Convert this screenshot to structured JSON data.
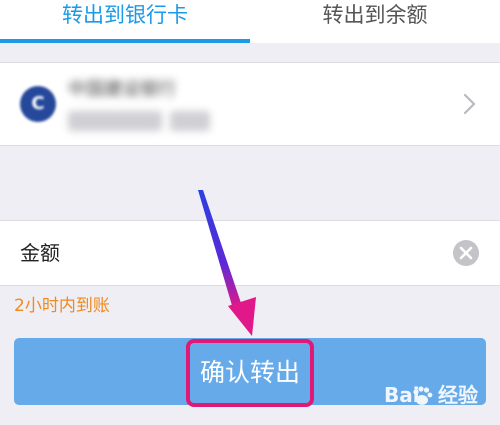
{
  "tabs": [
    {
      "label": "转出到银行卡",
      "active": true
    },
    {
      "label": "转出到余额",
      "active": false
    }
  ],
  "bank_card": {
    "logo_glyph": "C",
    "name": "中国建设银行"
  },
  "amount": {
    "label": "金额"
  },
  "arrival_note": "2小时内到账",
  "confirm_label": "确认转出",
  "watermark": {
    "text_a": "Bai",
    "text_b": "经验"
  },
  "icons": {
    "chevron": "chevron-right-icon",
    "clear": "clear-icon",
    "paw": "paw-icon"
  },
  "colors": {
    "accent": "#1a9ae8",
    "button": "#66aaea",
    "highlight": "#e01877",
    "note": "#f08a1c"
  }
}
